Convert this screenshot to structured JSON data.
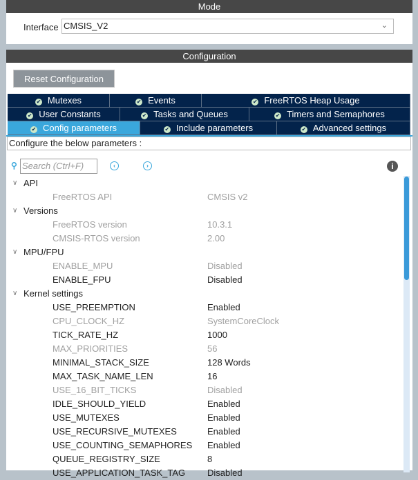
{
  "mode": {
    "title": "Mode",
    "interface_label": "Interface",
    "interface_value": "CMSIS_V2"
  },
  "config": {
    "title": "Configuration",
    "reset_label": "Reset Configuration",
    "tab_rows": [
      [
        {
          "label": "Mutexes",
          "w": 148
        },
        {
          "label": "Events",
          "w": 133
        },
        {
          "label": "FreeRTOS Heap Usage",
          "w": 302
        }
      ],
      [
        {
          "label": "User Constants",
          "w": 163
        },
        {
          "label": "Tasks and Queues",
          "w": 187
        },
        {
          "label": "Timers and Semaphores",
          "w": 233
        }
      ],
      [
        {
          "label": "Config parameters",
          "w": 192,
          "active": true
        },
        {
          "label": "Include parameters",
          "w": 198
        },
        {
          "label": "Advanced settings",
          "w": 193
        }
      ]
    ],
    "instruction": "Configure the below parameters :",
    "search_placeholder": "Search (Ctrl+F)",
    "tree": [
      {
        "group": "API",
        "rows": [
          {
            "name": "FreeRTOS API",
            "value": "CMSIS v2",
            "disabled": true
          }
        ]
      },
      {
        "group": "Versions",
        "rows": [
          {
            "name": "FreeRTOS version",
            "value": "10.3.1",
            "disabled": true
          },
          {
            "name": "CMSIS-RTOS version",
            "value": "2.00",
            "disabled": true
          }
        ]
      },
      {
        "group": "MPU/FPU",
        "rows": [
          {
            "name": "ENABLE_MPU",
            "value": "Disabled",
            "disabled": true
          },
          {
            "name": "ENABLE_FPU",
            "value": "Disabled",
            "disabled": false
          }
        ]
      },
      {
        "group": "Kernel settings",
        "rows": [
          {
            "name": "USE_PREEMPTION",
            "value": "Enabled",
            "disabled": false
          },
          {
            "name": "CPU_CLOCK_HZ",
            "value": "SystemCoreClock",
            "disabled": true
          },
          {
            "name": "TICK_RATE_HZ",
            "value": "1000",
            "disabled": false
          },
          {
            "name": "MAX_PRIORITIES",
            "value": "56",
            "disabled": true
          },
          {
            "name": "MINIMAL_STACK_SIZE",
            "value": "128 Words",
            "disabled": false
          },
          {
            "name": "MAX_TASK_NAME_LEN",
            "value": "16",
            "disabled": false
          },
          {
            "name": "USE_16_BIT_TICKS",
            "value": "Disabled",
            "disabled": true
          },
          {
            "name": "IDLE_SHOULD_YIELD",
            "value": "Enabled",
            "disabled": false
          },
          {
            "name": "USE_MUTEXES",
            "value": "Enabled",
            "disabled": false
          },
          {
            "name": "USE_RECURSIVE_MUTEXES",
            "value": "Enabled",
            "disabled": false
          },
          {
            "name": "USE_COUNTING_SEMAPHORES",
            "value": "Enabled",
            "disabled": false
          },
          {
            "name": "QUEUE_REGISTRY_SIZE",
            "value": "8",
            "disabled": false
          },
          {
            "name": "USE_APPLICATION_TASK_TAG",
            "value": "Disabled",
            "disabled": false
          }
        ]
      }
    ]
  }
}
